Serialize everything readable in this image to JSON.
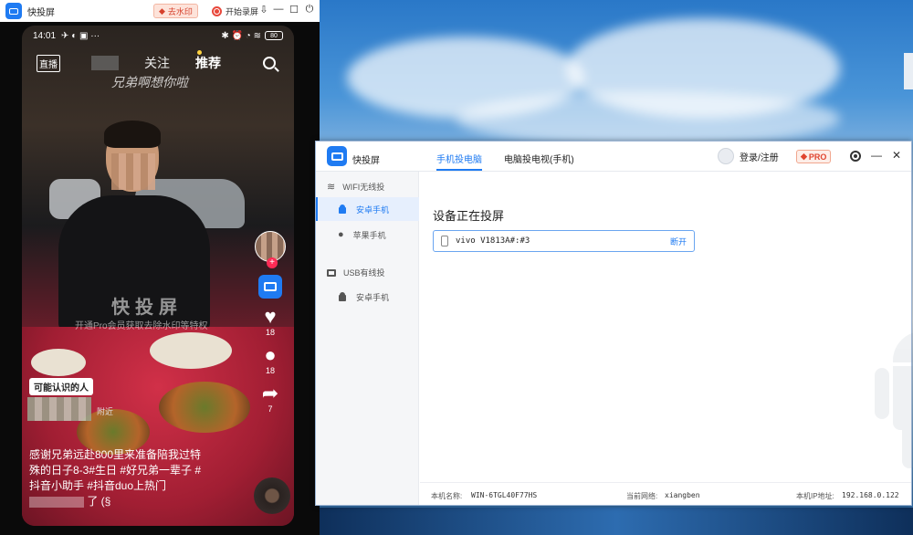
{
  "mirror_window": {
    "title": "快投屏",
    "watermark_button": "去水印",
    "record_button": "开始录屏",
    "controls": {
      "pin": "⇩",
      "minimize": "—",
      "maximize": "☐",
      "power": "⏻"
    }
  },
  "phone": {
    "status": {
      "time": "14:01",
      "battery": "80"
    },
    "nav": {
      "live": "直播",
      "follow": "关注",
      "recommend": "推荐"
    },
    "handwriting": "兄弟啊想你啦",
    "watermark_main": "快投屏",
    "watermark_sub": "开通Pro会员获取去除水印等特权",
    "actions": {
      "like_count": "18",
      "comment_count": "18",
      "share_count": "7"
    },
    "pill": "可能认识的人",
    "nearby": "附近",
    "caption": {
      "line1": "感谢兄弟远赴800里来准备陪我过特",
      "line2": "殊的日子8-3#生日 #好兄弟一辈子 #",
      "line3": "抖音小助手 #抖音duo上热门",
      "line4": "了 (§"
    }
  },
  "app": {
    "title": "快投屏",
    "tabs": [
      {
        "label": "手机投电脑",
        "active": true
      },
      {
        "label": "电脑投电视(手机)",
        "active": false
      }
    ],
    "login": "登录/注册",
    "pro": "PRO",
    "controls": {
      "minimize": "—",
      "close": "✕"
    },
    "sidebar": {
      "wifi_group": "WIFI无线投",
      "wifi_items": [
        {
          "label": "安卓手机",
          "active": true
        },
        {
          "label": "苹果手机",
          "active": false
        }
      ],
      "usb_group": "USB有线投",
      "usb_items": [
        {
          "label": "安卓手机",
          "active": false
        }
      ]
    },
    "main": {
      "section_title": "设备正在投屏",
      "device_name": "vivo V1813A#:#3",
      "disconnect": "断开"
    },
    "footer": {
      "host_label": "本机名称:",
      "host_value": "WIN-6TGL40F77HS",
      "network_label": "当前网络:",
      "network_value": "xiangben",
      "ip_label": "本机IP地址:",
      "ip_value": "192.168.0.122"
    }
  }
}
